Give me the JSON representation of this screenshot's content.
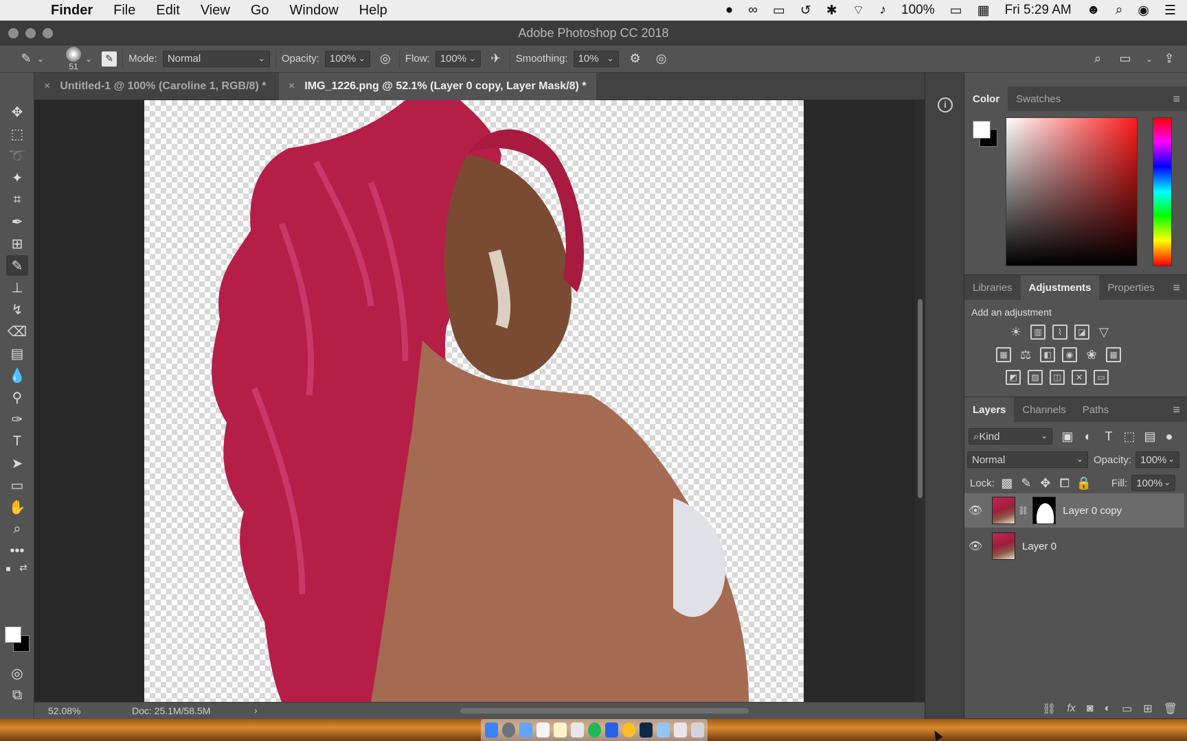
{
  "menubar": {
    "app": "Finder",
    "items": [
      "File",
      "Edit",
      "View",
      "Go",
      "Window",
      "Help"
    ],
    "battery": "100%",
    "clock": "Fri 5:29 AM"
  },
  "window": {
    "title": "Adobe Photoshop CC 2018"
  },
  "options": {
    "brush_size": "51",
    "mode_label": "Mode:",
    "mode_value": "Normal",
    "opacity_label": "Opacity:",
    "opacity_value": "100%",
    "flow_label": "Flow:",
    "flow_value": "100%",
    "smoothing_label": "Smoothing:",
    "smoothing_value": "10%"
  },
  "tabs": [
    {
      "label": "Untitled-1 @ 100% (Caroline 1, RGB/8) *"
    },
    {
      "label": "IMG_1226.png @ 52.1% (Layer 0 copy, Layer Mask/8) *"
    }
  ],
  "status": {
    "zoom": "52.08%",
    "doc": "Doc: 25.1M/58.5M"
  },
  "color_panel": {
    "tabs": [
      "Color",
      "Swatches"
    ]
  },
  "adj_panel": {
    "tabs": [
      "Libraries",
      "Adjustments",
      "Properties"
    ],
    "heading": "Add an adjustment"
  },
  "layers_panel": {
    "tabs": [
      "Layers",
      "Channels",
      "Paths"
    ],
    "kind_label": "Kind",
    "blend_mode": "Normal",
    "opacity_label": "Opacity:",
    "opacity_value": "100%",
    "lock_label": "Lock:",
    "fill_label": "Fill:",
    "fill_value": "100%",
    "layers": [
      {
        "name": "Layer 0 copy"
      },
      {
        "name": "Layer 0"
      }
    ]
  }
}
